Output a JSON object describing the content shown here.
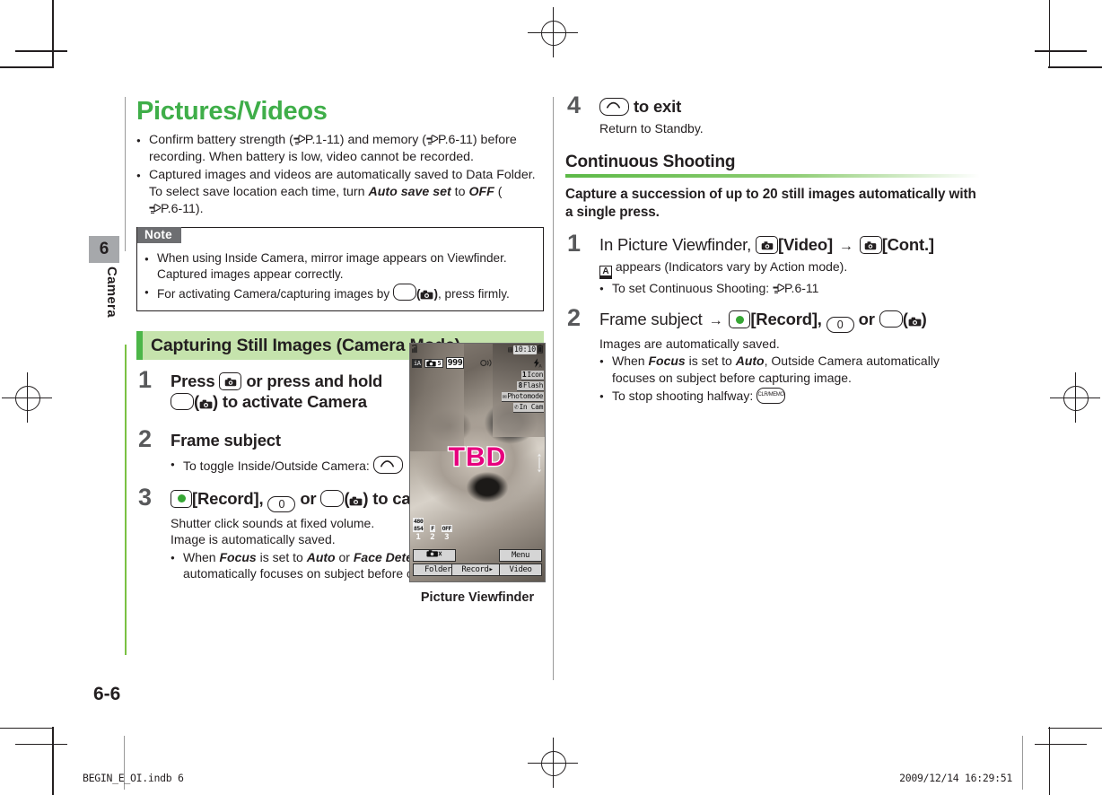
{
  "sidebar": {
    "chapter_number": "6",
    "chapter_name": "Camera"
  },
  "left_column": {
    "title": "Pictures/Videos",
    "intro_bullets": [
      "Confirm battery strength (☞P.1-11) and memory (☞P.6-11) before recording. When battery is low, video cannot be recorded.",
      "Captured images and videos are automatically saved to Data Folder. To select save location each time, turn Auto save set to OFF (☞P.6-11)."
    ],
    "note": {
      "label": "Note",
      "bullets": [
        "When using Inside Camera, mirror image appears on Viewfinder. Captured images appear correctly.",
        "For activating Camera/capturing images by ▢(☀), press firmly."
      ]
    },
    "section_header": "Capturing Still Images (Camera Mode)",
    "steps": [
      {
        "number": "1",
        "head_part1": "Press",
        "head_part2": "or press and hold",
        "head_part3": "to activate Camera"
      },
      {
        "number": "2",
        "head": "Frame subject",
        "bullets": [
          "To toggle Inside/Outside Camera:"
        ]
      },
      {
        "number": "3",
        "head_record": "[Record],",
        "head_or": "or",
        "head_tail": "to capture the image",
        "body_lines": [
          "Shutter click sounds at fixed volume.",
          "Image is automatically saved."
        ],
        "bullet_focus_pre": "When ",
        "bullet_focus_term1": "Focus",
        "bullet_focus_mid": " is set to ",
        "bullet_focus_term2": "Auto",
        "bullet_focus_or": " or ",
        "bullet_focus_term3": "Face Detection",
        "bullet_focus_post": ", Outside Camera automatically focuses on subject before capturing image."
      }
    ]
  },
  "right_column": {
    "step4": {
      "number": "4",
      "head": "to exit",
      "body": "Return to Standby."
    },
    "subhead": "Continuous Shooting",
    "lead": "Capture a succession of up to 20 still images automatically with a single press.",
    "steps": [
      {
        "number": "1",
        "head_pre": "In Picture Viewfinder,",
        "head_video": "[Video]",
        "head_arrow": "→",
        "head_cont": "[Cont.]",
        "body": "appears (Indicators vary by Action mode).",
        "bullet": "To set Continuous Shooting: ☞P.6-11"
      },
      {
        "number": "2",
        "head_pre": "Frame subject",
        "head_arrow": "→",
        "head_record": "[Record],",
        "head_or": "or",
        "body": "Images are automatically saved.",
        "bullet1_pre": "When ",
        "bullet1_term1": "Focus",
        "bullet1_mid": " is set to ",
        "bullet1_term2": "Auto",
        "bullet1_post": ", Outside Camera automatically focuses on subject before capturing image.",
        "bullet2": "To stop shooting halfway:"
      }
    ]
  },
  "screenshot": {
    "caption": "Picture Viewfinder",
    "status": {
      "signal": "signal-icon",
      "clock": "10:10",
      "battery": "battery-icon"
    },
    "indicators": {
      "action_mode": "iA",
      "shots_remaining": "999",
      "mic": "mic-icon",
      "flash": "flash-auto-icon"
    },
    "side_menu": [
      {
        "key": "1",
        "label": "Icon"
      },
      {
        "key": "8",
        "label": "Flash"
      },
      {
        "key": "✉",
        "label": "Photomode"
      },
      {
        "key": "✆",
        "label": "In Cam"
      }
    ],
    "watermark": "TBD",
    "bottom_indicators": [
      {
        "badge": "480\n854",
        "num": "1"
      },
      {
        "badge": "F",
        "num": "2"
      },
      {
        "badge": "OFF",
        "num": "3"
      }
    ],
    "softkeys": {
      "top_left": "camera-off-icon",
      "bottom_left": "Folder",
      "center": "Record",
      "top_right": "Menu",
      "bottom_right": "Video"
    }
  },
  "footer": {
    "page_number": "6-6",
    "file_name": "BEGIN_E_OI.indb    6",
    "timestamp": "2009/12/14    16:29:51"
  },
  "colors": {
    "title_green": "#3fae49",
    "section_bg": "#c5e3ac",
    "section_accent": "#4cb648",
    "note_label_bg": "#6d6e71",
    "step_num": "#58595b",
    "watermark_pink": "#e6007e",
    "record_dot_green": "#36a634"
  }
}
